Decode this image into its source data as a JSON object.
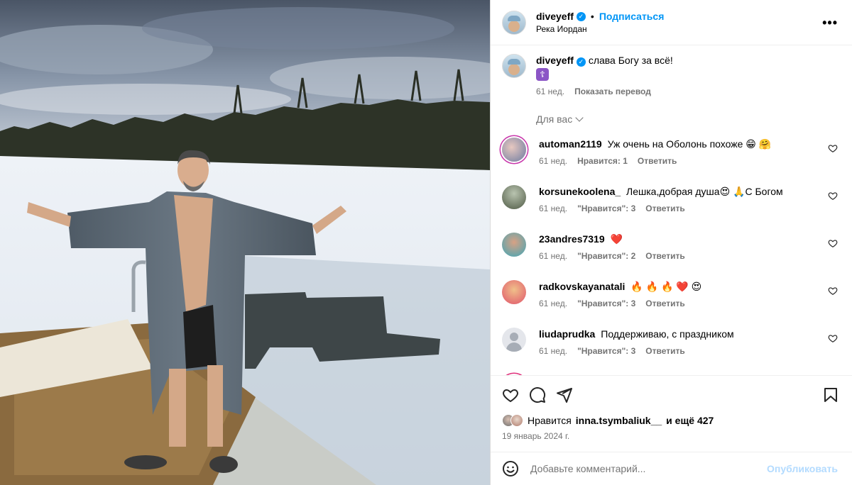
{
  "post": {
    "username": "diveyeff",
    "follow_label": "Подписаться",
    "dot": "•",
    "location": "Река Иордан",
    "more_label": "•••"
  },
  "caption": {
    "username": "diveyeff",
    "text": "слава Богу за всё!",
    "emoji": "☦",
    "time": "61 нед.",
    "translate_label": "Показать перевод"
  },
  "for_you_label": "Для вас",
  "comments": [
    {
      "username": "automan2119",
      "text": "Уж очень на Оболонь похоже 😁 🤗",
      "time": "61 нед.",
      "likes": "Нравится: 1",
      "reply": "Ответить"
    },
    {
      "username": "korsunekoolena_",
      "text": "Лешка,добрая душа😍 🙏С Богом",
      "time": "61 нед.",
      "likes": "\"Нравится\": 3",
      "reply": "Ответить"
    },
    {
      "username": "23andres7319",
      "text": "❤️",
      "time": "61 нед.",
      "likes": "\"Нравится\": 2",
      "reply": "Ответить"
    },
    {
      "username": "radkovskayanatali",
      "text": "🔥 🔥 🔥 ❤️ 😍",
      "time": "61 нед.",
      "likes": "\"Нравится\": 3",
      "reply": "Ответить"
    },
    {
      "username": "liudaprudka",
      "text": "Поддерживаю, с праздником",
      "time": "61 нед.",
      "likes": "\"Нравится\": 3",
      "reply": "Ответить"
    }
  ],
  "likes": {
    "prefix": "Нравится",
    "user": "inna.tsymbaliuk__",
    "suffix": "и ещё 427"
  },
  "date": "19 январь 2024 г.",
  "add_comment": {
    "placeholder": "Добавьте комментарий...",
    "publish_label": "Опубликовать"
  },
  "colors": {
    "link": "#0095f6",
    "secondary_text": "#737373",
    "publish_disabled": "#b3dbff"
  }
}
